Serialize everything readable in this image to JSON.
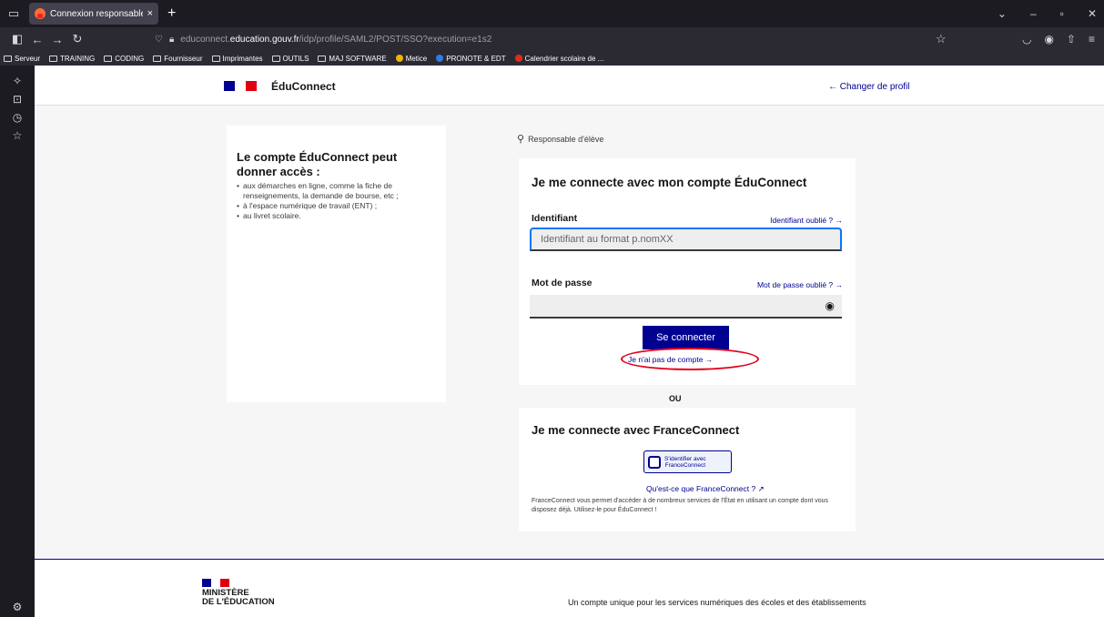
{
  "browser": {
    "tab_title": "Connexion responsable - ÉduCo",
    "tab_close": "×",
    "new_tab": "+",
    "url_prefix": "educonnect.",
    "url_domain": "education.gouv.fr",
    "url_path": "/idp/profile/SAML2/POST/SSO?execution=e1s2",
    "bookmarks": [
      "Serveur",
      "TRAINING",
      "CODING",
      "Fournisseur",
      "Imprimantes",
      "OUTILS",
      "MAJ SOFTWARE",
      "Metice",
      "PRONOTE & EDT",
      "Calendrier scolaire de ..."
    ],
    "bookmark_colors": {
      "Metice": "#f0b400",
      "PRONOTE & EDT": "#2b7de9",
      "Calendrier scolaire de ...": "#e22b1c"
    }
  },
  "header": {
    "brand": "ÉduConnect",
    "change_profile": "← Changer de profil"
  },
  "info": {
    "title": "Le compte ÉduConnect peut donner accès :",
    "items": [
      "aux démarches en ligne, comme la fiche de renseignements, la demande de bourse, etc ;",
      "à l'espace numérique de travail (ENT) ;",
      "au livret scolaire."
    ]
  },
  "role": {
    "label": "Responsable d'élève"
  },
  "login": {
    "title": "Je me connecte avec mon compte ÉduConnect",
    "id_label": "Identifiant",
    "id_forgot": "Identifiant oublié ? →",
    "id_placeholder": "Identifiant au format p.nomXX",
    "pw_label": "Mot de passe",
    "pw_forgot": "Mot de passe oublié ? →",
    "connect": "Se connecter",
    "no_account": "Je n'ai pas de compte →"
  },
  "separator": "OU",
  "franceconnect": {
    "title": "Je me connecte avec FranceConnect",
    "button_line1": "S'identifier avec",
    "button_line2": "FranceConnect",
    "what_link": "Qu'est-ce que FranceConnect ? ↗",
    "description": "FranceConnect vous permet d'accéder à de nombreux services de l'État en utilisant un compte dont vous disposez déjà. Utilisez-le pour ÉduConnect !"
  },
  "footer": {
    "ministry_line1": "MINISTÈRE",
    "ministry_line2": "DE L'ÉDUCATION",
    "tagline": "Un compte unique pour les services numériques des écoles et des établissements"
  },
  "colors": {
    "primary": "#000091",
    "highlight": "#e3001b",
    "flag_blue": "#000091",
    "flag_white": "#ffffff",
    "flag_red": "#e1000f"
  }
}
